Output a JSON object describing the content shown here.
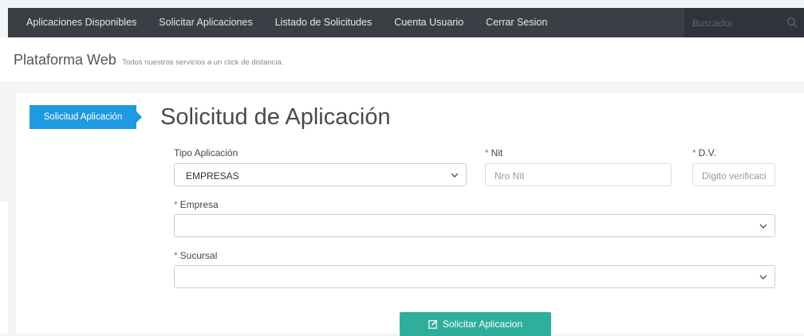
{
  "nav": {
    "items": [
      {
        "label": "Aplicaciones Disponibles"
      },
      {
        "label": "Solicitar Aplicaciones"
      },
      {
        "label": "Listado de Solicitudes"
      },
      {
        "label": "Cuenta Usuario"
      },
      {
        "label": "Cerrar Sesion"
      }
    ],
    "search_placeholder": "Buscador",
    "search_icon": "search-icon"
  },
  "header": {
    "title": "Plataforma Web",
    "subtitle": "Todos nuestros servicios a un click de distancia."
  },
  "form": {
    "step_label": "Solicitud Aplicación",
    "title": "Solicitud de Aplicación",
    "required_mark": "*",
    "tipo": {
      "label": "Tipo Aplicación",
      "value": "EMPRESAS"
    },
    "nit": {
      "label": "Nit",
      "placeholder": "Nro Nit"
    },
    "dv": {
      "label": "D.V.",
      "placeholder": "Digito verificaci"
    },
    "empresa": {
      "label": "Empresa",
      "value": ""
    },
    "sucursal": {
      "label": "Sucursal",
      "value": ""
    },
    "submit_label": "Solicitar Aplicacion",
    "submit_icon": "edit-icon"
  },
  "colors": {
    "nav_bg": "#3a3f45",
    "accent_blue": "#1f9ae0",
    "button_teal": "#2fae9b",
    "required_red": "#d9534f"
  }
}
